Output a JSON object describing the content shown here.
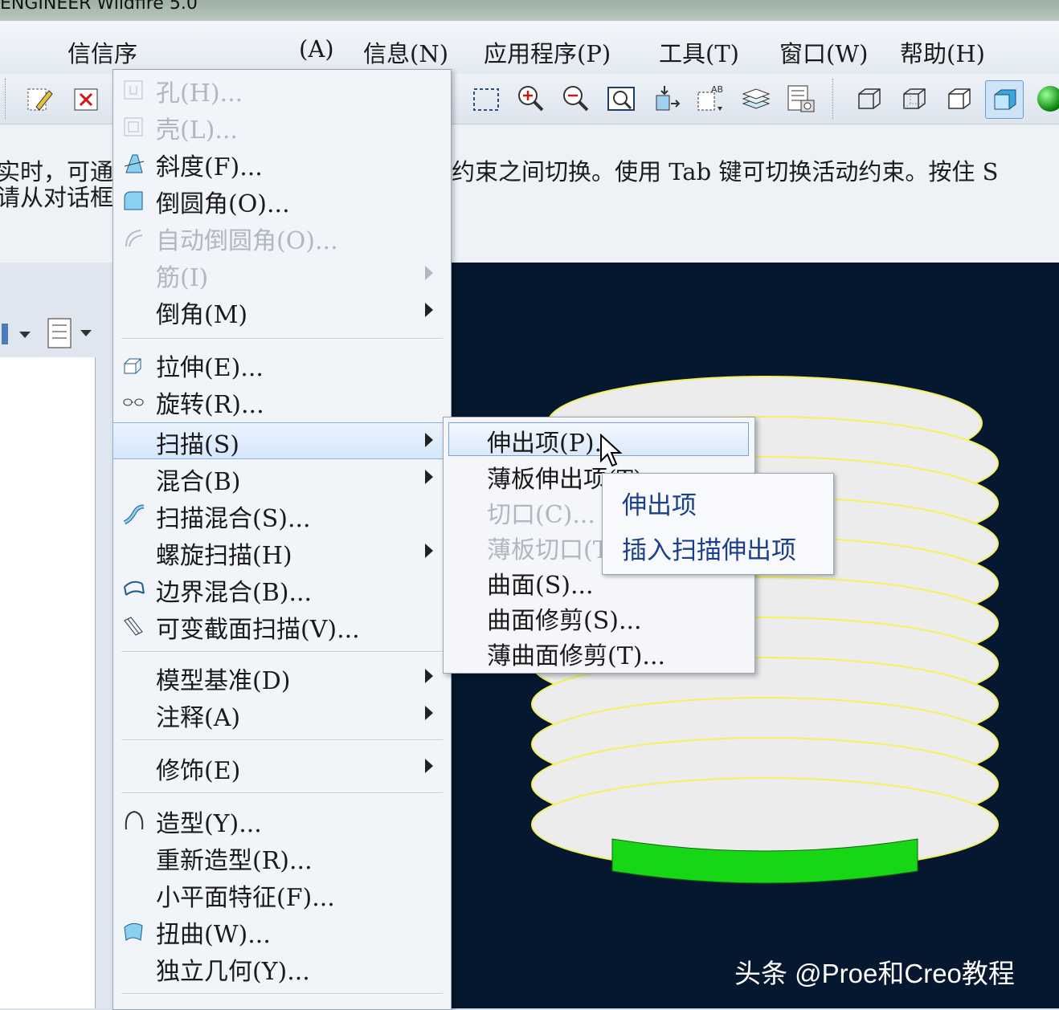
{
  "window": {
    "title": "ENGINEER Wildfire 5.0"
  },
  "menubar": {
    "items": [
      "信信序",
      "(A)",
      "信息(N)",
      "应用程序(P)",
      "工具(T)",
      "窗口(W)",
      "帮助(H)"
    ]
  },
  "toolbar": {
    "icons": [
      "pencil-icon",
      "close-icon",
      "select-box-icon",
      "zoom-in-icon",
      "zoom-out-icon",
      "zoom-fit-icon",
      "reorient-icon",
      "view-manager-icon",
      "layers-icon",
      "saved-views-icon",
      "wireframe-icon",
      "hidden-line-icon",
      "no-hidden-icon",
      "shading-icon",
      "render-sphere-icon"
    ]
  },
  "message_area": {
    "left_line1": "实时，可通",
    "left_line2": "请从对话框",
    "right_line1": "约束之间切换。使用 Tab 键可切换活动约束。按住 S"
  },
  "insert_menu": {
    "items": [
      {
        "label": "孔(H)...",
        "enabled": false,
        "arrow": false
      },
      {
        "label": "壳(L)...",
        "enabled": false,
        "arrow": false
      },
      {
        "label": "斜度(F)...",
        "enabled": true,
        "arrow": false
      },
      {
        "label": "倒圆角(O)...",
        "enabled": true,
        "arrow": false
      },
      {
        "label": "自动倒圆角(O)...",
        "enabled": false,
        "arrow": false
      },
      {
        "label": "筋(I)",
        "enabled": false,
        "arrow": true
      },
      {
        "label": "倒角(M)",
        "enabled": true,
        "arrow": true
      },
      {
        "label": "拉伸(E)...",
        "enabled": true,
        "arrow": false
      },
      {
        "label": "旋转(R)...",
        "enabled": true,
        "arrow": false
      },
      {
        "label": "扫描(S)",
        "enabled": true,
        "arrow": true
      },
      {
        "label": "混合(B)",
        "enabled": true,
        "arrow": true
      },
      {
        "label": "扫描混合(S)...",
        "enabled": true,
        "arrow": false
      },
      {
        "label": "螺旋扫描(H)",
        "enabled": true,
        "arrow": true
      },
      {
        "label": "边界混合(B)...",
        "enabled": true,
        "arrow": false
      },
      {
        "label": "可变截面扫描(V)...",
        "enabled": true,
        "arrow": false
      },
      {
        "label": "模型基准(D)",
        "enabled": true,
        "arrow": true
      },
      {
        "label": "注释(A)",
        "enabled": true,
        "arrow": true
      },
      {
        "label": "修饰(E)",
        "enabled": true,
        "arrow": true
      },
      {
        "label": "造型(Y)...",
        "enabled": true,
        "arrow": false
      },
      {
        "label": "重新造型(R)...",
        "enabled": true,
        "arrow": false
      },
      {
        "label": "小平面特征(F)...",
        "enabled": true,
        "arrow": false
      },
      {
        "label": "扭曲(W)...",
        "enabled": true,
        "arrow": false
      },
      {
        "label": "独立几何(Y)...",
        "enabled": true,
        "arrow": false
      }
    ],
    "highlighted": "扫描(S)"
  },
  "sweep_submenu": {
    "items": [
      {
        "label": "伸出项(P)...",
        "enabled": true
      },
      {
        "label": "薄板伸出项(T)...",
        "enabled": true
      },
      {
        "label": "切口(C)...",
        "enabled": false
      },
      {
        "label": "薄板切口(T)...",
        "enabled": false
      },
      {
        "label": "曲面(S)...",
        "enabled": true
      },
      {
        "label": "曲面修剪(S)...",
        "enabled": true
      },
      {
        "label": "薄曲面修剪(T)...",
        "enabled": true
      }
    ],
    "highlighted": "伸出项(P)..."
  },
  "tooltip": {
    "line1": "伸出项",
    "line2": "插入扫描伸出项"
  },
  "viewport": {
    "background": "#061830",
    "coil_color": "#16d616",
    "surface_color": "#ececec",
    "edge_color": "#f5f060"
  },
  "watermark": {
    "text": "头条 @Proe和Creo教程"
  }
}
